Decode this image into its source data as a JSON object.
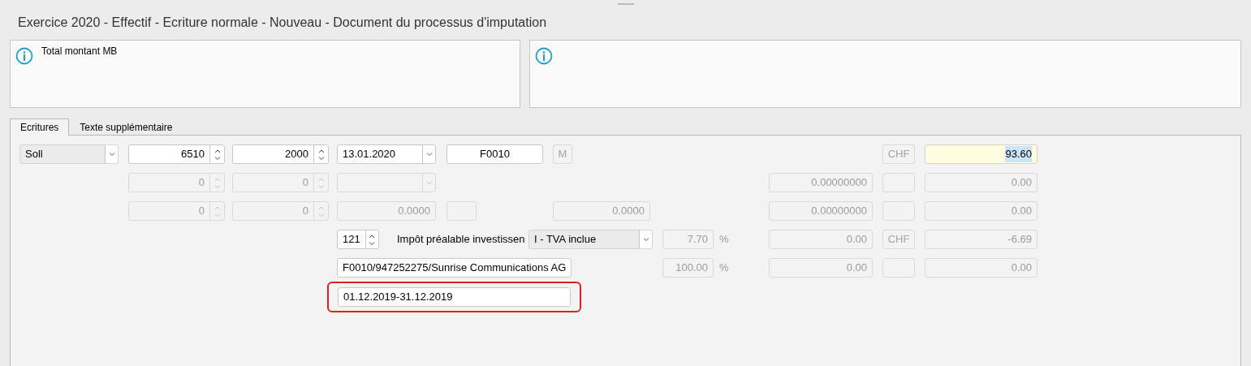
{
  "window": {
    "title": "Exercice 2020 - Effectif - Ecriture normale - Nouveau - Document du processus d'imputation"
  },
  "info_panels": [
    {
      "kind": "info",
      "text": "Total montant MB"
    },
    {
      "kind": "info"
    }
  ],
  "tabs": [
    {
      "label": "Ecritures",
      "selected": true
    },
    {
      "label": "Texte supplémentaire",
      "selected": false
    }
  ],
  "lines": [
    [
      {
        "kind": "select",
        "value": "Soll",
        "disabled": false
      },
      {
        "kind": "spinner",
        "value": "6510",
        "disabled": false
      },
      {
        "kind": "spinner",
        "value": "2000",
        "disabled": false
      },
      {
        "kind": "date",
        "value": "13.01.2020",
        "disabled": false
      },
      {
        "kind": "field",
        "value": "F0010",
        "disabled": false
      },
      {
        "kind": "button",
        "value": "M",
        "disabled": true
      },
      {
        "kind": "button",
        "value": "CHF",
        "disabled": true
      },
      {
        "kind": "field",
        "value": "93.60",
        "disabled": false,
        "highlighted": true
      }
    ],
    [
      {
        "kind": "spinner",
        "value": "0",
        "disabled": true
      },
      {
        "kind": "spinner",
        "value": "0",
        "disabled": true
      },
      {
        "kind": "select",
        "disabled": true
      },
      {
        "kind": "field",
        "value": "0.00000000",
        "disabled": true
      },
      {
        "kind": "button",
        "disabled": true
      },
      {
        "kind": "field",
        "value": "0.00",
        "disabled": true
      }
    ],
    [
      {
        "kind": "spinner",
        "value": "0",
        "disabled": true
      },
      {
        "kind": "spinner",
        "value": "0",
        "disabled": true
      },
      {
        "kind": "field",
        "value": "0.0000",
        "disabled": true
      },
      {
        "kind": "button",
        "disabled": true
      },
      {
        "kind": "field",
        "value": "0.0000",
        "disabled": true
      },
      {
        "kind": "field",
        "value": "0.00000000",
        "disabled": true
      },
      {
        "kind": "button",
        "disabled": true
      },
      {
        "kind": "field",
        "value": "0.00",
        "disabled": true
      }
    ],
    [
      {
        "kind": "spinner",
        "value": "121",
        "disabled": false
      },
      {
        "kind": "label",
        "value": "Impôt préalable investissen"
      },
      {
        "kind": "select",
        "value": "I - TVA inclue",
        "disabled": false
      },
      {
        "kind": "percent",
        "value": "7.70",
        "unit": "%",
        "disabled": true
      },
      {
        "kind": "field",
        "value": "0.00",
        "disabled": true
      },
      {
        "kind": "button",
        "value": "CHF",
        "disabled": true
      },
      {
        "kind": "field",
        "value": "-6.69",
        "disabled": true
      }
    ],
    [
      {
        "kind": "field",
        "value": "F0010/947252275/Sunrise Communications AG",
        "disabled": false
      },
      {
        "kind": "percent",
        "value": "100.00",
        "unit": "%",
        "disabled": true
      },
      {
        "kind": "field",
        "value": "0.00",
        "disabled": true
      },
      {
        "kind": "button",
        "disabled": true
      },
      {
        "kind": "field",
        "value": "0.00",
        "disabled": true
      }
    ],
    [
      {
        "kind": "field",
        "value": "01.12.2019-31.12.2019",
        "disabled": false,
        "outlined": true
      }
    ]
  ]
}
